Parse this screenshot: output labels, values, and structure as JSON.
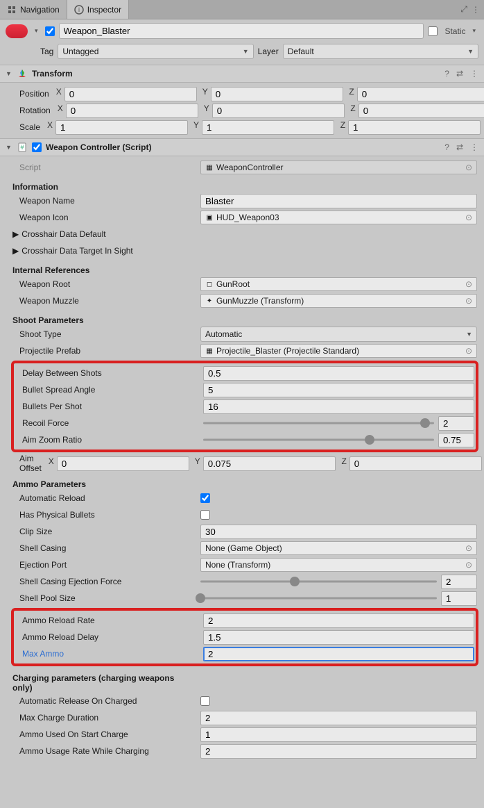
{
  "tabs": {
    "nav": "Navigation",
    "inspector": "Inspector"
  },
  "header": {
    "name": "Weapon_Blaster",
    "static": "Static",
    "tagLabel": "Tag",
    "tagValue": "Untagged",
    "layerLabel": "Layer",
    "layerValue": "Default"
  },
  "transform": {
    "title": "Transform",
    "position": {
      "label": "Position",
      "x": "0",
      "y": "0",
      "z": "0"
    },
    "rotation": {
      "label": "Rotation",
      "x": "0",
      "y": "0",
      "z": "0"
    },
    "scale": {
      "label": "Scale",
      "x": "1",
      "y": "1",
      "z": "1"
    }
  },
  "wc": {
    "title": "Weapon Controller (Script)",
    "scriptLabel": "Script",
    "scriptValue": "WeaponController",
    "info": {
      "header": "Information",
      "name": {
        "label": "Weapon Name",
        "value": "Blaster"
      },
      "icon": {
        "label": "Weapon Icon",
        "value": "HUD_Weapon03"
      },
      "crosshairDefault": "Crosshair Data Default",
      "crosshairTarget": "Crosshair Data Target In Sight"
    },
    "refs": {
      "header": "Internal References",
      "root": {
        "label": "Weapon Root",
        "value": "GunRoot"
      },
      "muzzle": {
        "label": "Weapon Muzzle",
        "value": "GunMuzzle (Transform)"
      }
    },
    "shoot": {
      "header": "Shoot Parameters",
      "type": {
        "label": "Shoot Type",
        "value": "Automatic"
      },
      "prefab": {
        "label": "Projectile Prefab",
        "value": "Projectile_Blaster (Projectile Standard)"
      },
      "delay": {
        "label": "Delay Between Shots",
        "value": "0.5"
      },
      "spread": {
        "label": "Bullet Spread Angle",
        "value": "5"
      },
      "bullets": {
        "label": "Bullets Per Shot",
        "value": "16"
      },
      "recoil": {
        "label": "Recoil Force",
        "value": "2",
        "pct": 96
      },
      "zoom": {
        "label": "Aim Zoom Ratio",
        "value": "0.75",
        "pct": 72
      },
      "offset": {
        "label": "Aim Offset",
        "x": "0",
        "y": "0.075",
        "z": "0"
      }
    },
    "ammo": {
      "header": "Ammo Parameters",
      "autoReload": {
        "label": "Automatic Reload",
        "checked": true
      },
      "physBullets": {
        "label": "Has Physical Bullets",
        "checked": false
      },
      "clip": {
        "label": "Clip Size",
        "value": "30"
      },
      "shell": {
        "label": "Shell Casing",
        "value": "None (Game Object)"
      },
      "eject": {
        "label": "Ejection Port",
        "value": "None (Transform)"
      },
      "ejectForce": {
        "label": "Shell Casing Ejection Force",
        "value": "2",
        "pct": 40
      },
      "poolSize": {
        "label": "Shell Pool Size",
        "value": "1",
        "pct": 0
      },
      "reloadRate": {
        "label": "Ammo Reload Rate",
        "value": "2"
      },
      "reloadDelay": {
        "label": "Ammo Reload Delay",
        "value": "1.5"
      },
      "maxAmmo": {
        "label": "Max Ammo",
        "value": "2"
      }
    },
    "charge": {
      "header": "Charging parameters (charging weapons only)",
      "autoRelease": {
        "label": "Automatic Release On Charged",
        "checked": false
      },
      "maxDuration": {
        "label": "Max Charge Duration",
        "value": "2"
      },
      "usedStart": {
        "label": "Ammo Used On Start Charge",
        "value": "1"
      },
      "usageRate": {
        "label": "Ammo Usage Rate While Charging",
        "value": "2"
      }
    }
  }
}
